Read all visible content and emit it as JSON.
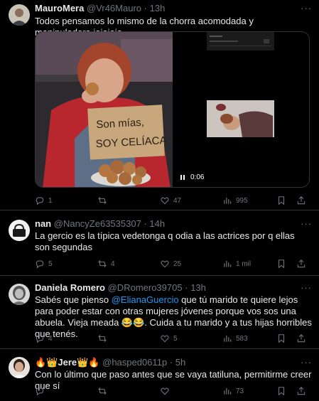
{
  "tweets": [
    {
      "name": "MauroMera",
      "handle": "@Vr46Mauro",
      "dot": "·",
      "time": "13h",
      "more": "···",
      "text": "Todos pensamos lo mismo de la chorra acomodada y manipuladora jajajaja",
      "media": {
        "sign_line1": "Son mías,",
        "sign_line2": "SOY CELÍACA",
        "video_time": "0:06"
      },
      "actions": {
        "replies": "1",
        "retweets": "",
        "likes": "47",
        "views": "995"
      }
    },
    {
      "name": "nan",
      "handle": "@NancyZe63535307",
      "dot": "·",
      "time": "14h",
      "more": "···",
      "text": "La gercio es la típica vedetonga q odia a las actrices por q ellas son segundas",
      "actions": {
        "replies": "5",
        "retweets": "4",
        "likes": "25",
        "views": "1 mil"
      }
    },
    {
      "name": "Daniela Romero",
      "handle": "@DRomero39705",
      "dot": "·",
      "time": "13h",
      "more": "···",
      "text_before": "Sabés que pienso ",
      "mention": "@ElianaGuercio",
      "text_after": " que tú marido te quiere lejos para poder estar con otras mujeres jóvenes porque vos sos una abuela. Vieja meada 😂😂. Cuida a tu marido y a tus hijas horribles que tenés.",
      "actions": {
        "replies": "4",
        "retweets": "",
        "likes": "5",
        "views": "583"
      }
    },
    {
      "name": "🔥👑Jere👑🔥",
      "handle": "@hasped0611p",
      "dot": "·",
      "time": "5h",
      "more": "···",
      "text": "Con lo último que paso antes que se vaya tatiluna, permitirme creer que sí",
      "actions": {
        "replies": "",
        "retweets": "",
        "likes": "",
        "views": "73"
      }
    }
  ],
  "colors": {
    "background": "#000000",
    "text": "#e7e9ea",
    "muted": "#71767b",
    "mention": "#1d9bf0",
    "border": "#2f3336"
  },
  "icons": [
    "reply-icon",
    "retweet-icon",
    "like-icon",
    "views-icon",
    "bookmark-icon",
    "share-icon",
    "pause-icon"
  ]
}
